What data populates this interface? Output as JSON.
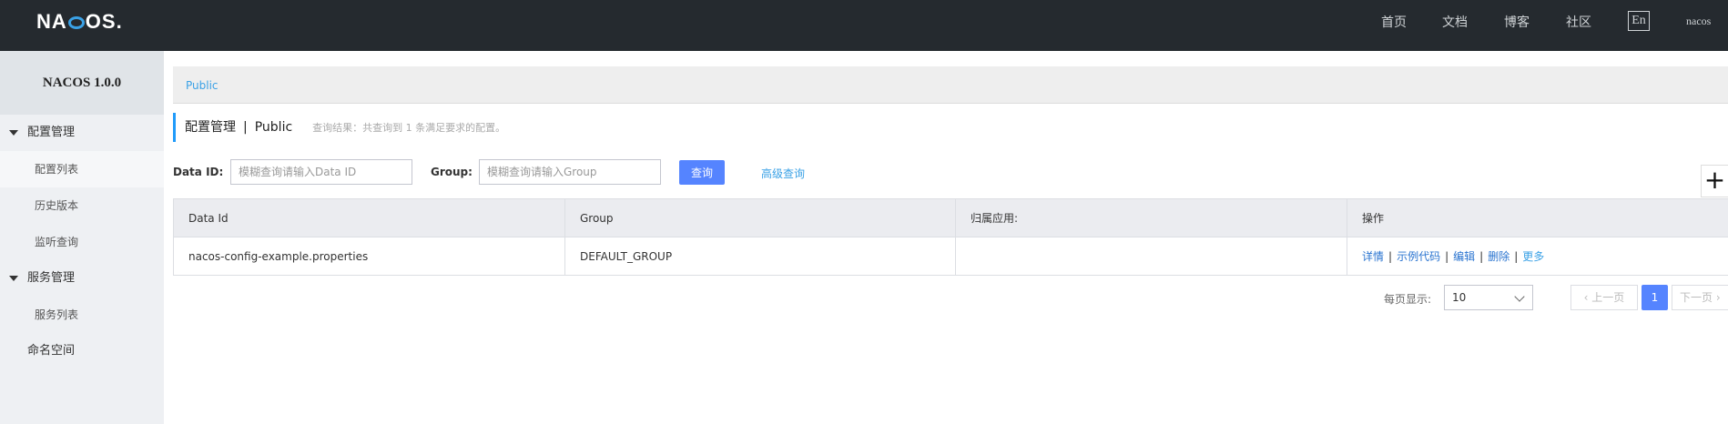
{
  "header": {
    "logo": "NACOS.",
    "nav": [
      "首页",
      "文档",
      "博客",
      "社区"
    ],
    "lang": "En",
    "user": "nacos"
  },
  "sidebar": {
    "version": "NACOS 1.0.0",
    "groups": [
      {
        "label": "配置管理",
        "items": [
          "配置列表",
          "历史版本",
          "监听查询"
        ]
      },
      {
        "label": "服务管理",
        "items": [
          "服务列表"
        ]
      }
    ],
    "namespace": "命名空间"
  },
  "breadcrumb": "Public",
  "title": {
    "section": "配置管理",
    "separator": "|",
    "namespace": "Public",
    "result": "查询结果：共查询到 1 条满足要求的配置。"
  },
  "filters": {
    "dataid_label": "Data ID:",
    "dataid_placeholder": "模糊查询请输入Data ID",
    "group_label": "Group:",
    "group_placeholder": "模糊查询请输入Group",
    "query_button": "查询",
    "advanced": "高级查询",
    "add": "+"
  },
  "table": {
    "headers": [
      "Data Id",
      "Group",
      "归属应用:",
      "操作"
    ],
    "rows": [
      {
        "dataid": "nacos-config-example.properties",
        "group": "DEFAULT_GROUP",
        "app": ""
      }
    ],
    "actions": [
      "详情",
      "示例代码",
      "编辑",
      "删除",
      "更多"
    ]
  },
  "pager": {
    "per_page_label": "每页显示:",
    "per_page_value": "10",
    "prev": "上一页",
    "current": "1",
    "next": "下一页"
  }
}
